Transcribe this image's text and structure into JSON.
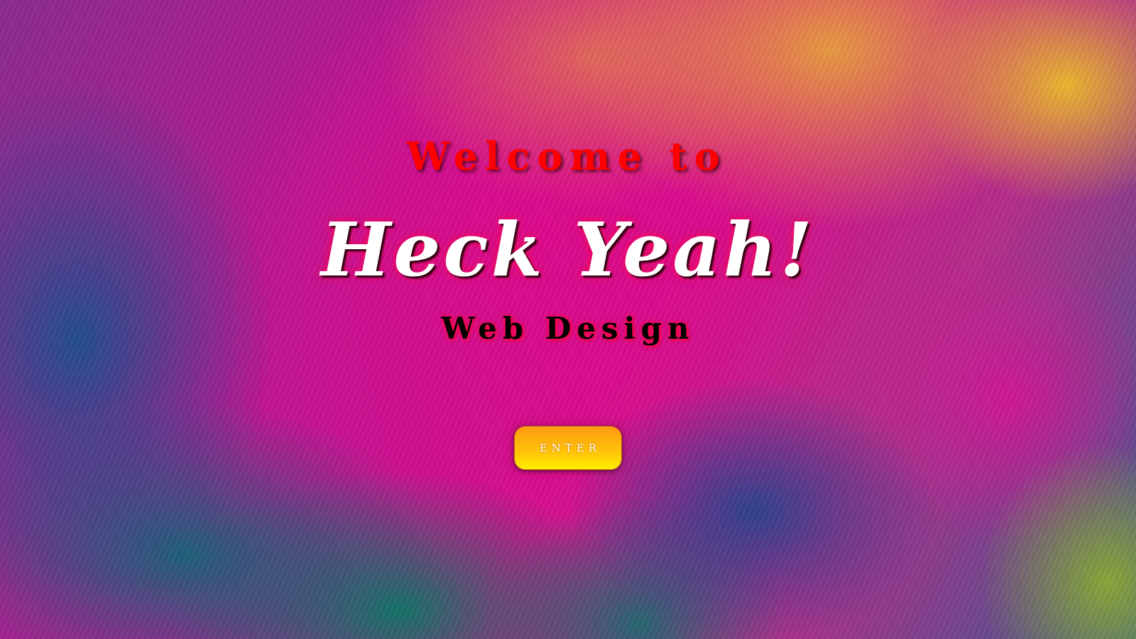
{
  "hero": {
    "welcome_text": "Welcome to",
    "title": "Heck Yeah!",
    "subtitle": "Web Design",
    "enter_button_label": "ENTER"
  },
  "colors": {
    "welcome_text": "#ff0000",
    "title_text": "#ffffff",
    "subtitle_text": "#000000",
    "button_gradient_top": "#ff9a10",
    "button_gradient_bottom": "#ffee00",
    "background_primary": "#d80d8e"
  }
}
